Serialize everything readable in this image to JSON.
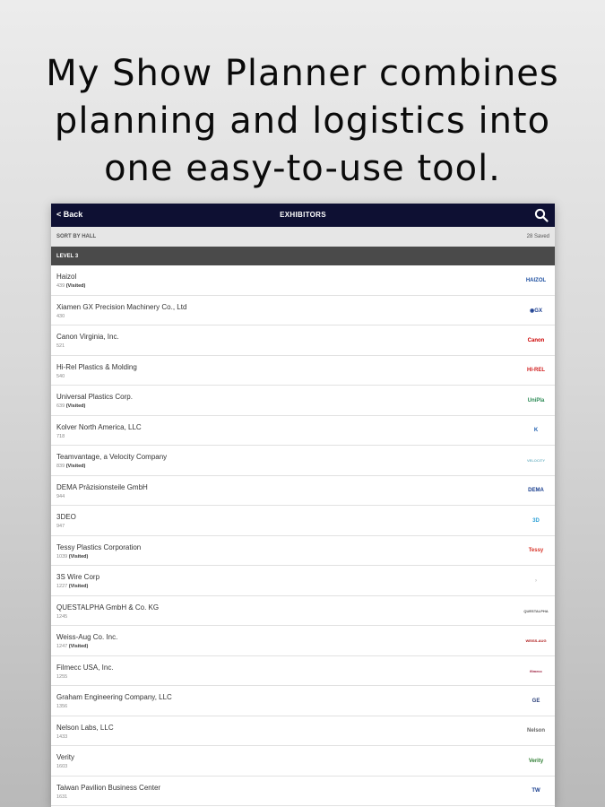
{
  "headline": {
    "line1": "My Show Planner combines",
    "line2": "planning and logistics into",
    "line3": "one easy-to-use tool."
  },
  "navbar": {
    "back_label": "< Back",
    "title": "EXHIBITORS"
  },
  "sortbar": {
    "sort_label": "SORT BY HALL",
    "saved_count": "28 Saved"
  },
  "section": {
    "label": "LEVEL 3"
  },
  "exhibitors": [
    {
      "name": "Haizol",
      "booth": "439",
      "visited": "(Visited)",
      "logo": {
        "text": "HAIZOL",
        "color": "#1d4fa0"
      }
    },
    {
      "name": "Xiamen GX Precision Machinery Co., Ltd",
      "booth": "430",
      "visited": "",
      "logo": {
        "text": "◉GX",
        "color": "#1a3d8f"
      }
    },
    {
      "name": "Canon Virginia, Inc.",
      "booth": "521",
      "visited": "",
      "logo": {
        "text": "Canon",
        "color": "#cc0000"
      }
    },
    {
      "name": "Hi-Rel Plastics & Molding",
      "booth": "540",
      "visited": "",
      "logo": {
        "text": "HI-REL",
        "color": "#d12020"
      }
    },
    {
      "name": "Universal Plastics Corp.",
      "booth": "639",
      "visited": "(Visited)",
      "logo": {
        "text": "UniPla",
        "color": "#2e8b57"
      }
    },
    {
      "name": "Kolver North America, LLC",
      "booth": "718",
      "visited": "",
      "logo": {
        "text": "K",
        "color": "#1f5fb0"
      }
    },
    {
      "name": "Teamvantage, a Velocity Company",
      "booth": "839",
      "visited": "(Visited)",
      "logo": {
        "text": "VELOCITY",
        "color": "#7ab8c8"
      }
    },
    {
      "name": "DEMA Präzisionsteile GmbH",
      "booth": "944",
      "visited": "",
      "logo": {
        "text": "DEMA",
        "color": "#1a3f8f"
      }
    },
    {
      "name": "3DEO",
      "booth": "947",
      "visited": "",
      "logo": {
        "text": "3D",
        "color": "#2a9fd6"
      }
    },
    {
      "name": "Tessy Plastics Corporation",
      "booth": "1039",
      "visited": "(Visited)",
      "logo": {
        "text": "Tessy",
        "color": "#d8342a"
      }
    },
    {
      "name": "3S Wire Corp",
      "booth": "1227",
      "visited": "(Visited)",
      "logo": {
        "text": "›",
        "color": "#bbbbbb"
      }
    },
    {
      "name": "QUESTALPHA GmbH & Co. KG",
      "booth": "1245",
      "visited": "",
      "logo": {
        "text": "QUESTALPHA",
        "color": "#555555"
      }
    },
    {
      "name": "Weiss-Aug Co. Inc.",
      "booth": "1247",
      "visited": "(Visited)",
      "logo": {
        "text": "WEISS-AUG",
        "color": "#b02020"
      }
    },
    {
      "name": "Filmecc USA, Inc.",
      "booth": "1255",
      "visited": "",
      "logo": {
        "text": "filmecc",
        "color": "#9a1a3a"
      }
    },
    {
      "name": "Graham Engineering Company, LLC",
      "booth": "1356",
      "visited": "",
      "logo": {
        "text": "GE",
        "color": "#2a3f7a"
      }
    },
    {
      "name": "Nelson Labs, LLC",
      "booth": "1433",
      "visited": "",
      "logo": {
        "text": "Nelson",
        "color": "#666666"
      }
    },
    {
      "name": "Verity",
      "booth": "1603",
      "visited": "",
      "logo": {
        "text": "Verity",
        "color": "#2e7d32"
      }
    },
    {
      "name": "Taiwan Pavilion Business Center",
      "booth": "1631",
      "visited": "",
      "logo": {
        "text": "TW",
        "color": "#1a3f8f"
      }
    }
  ]
}
